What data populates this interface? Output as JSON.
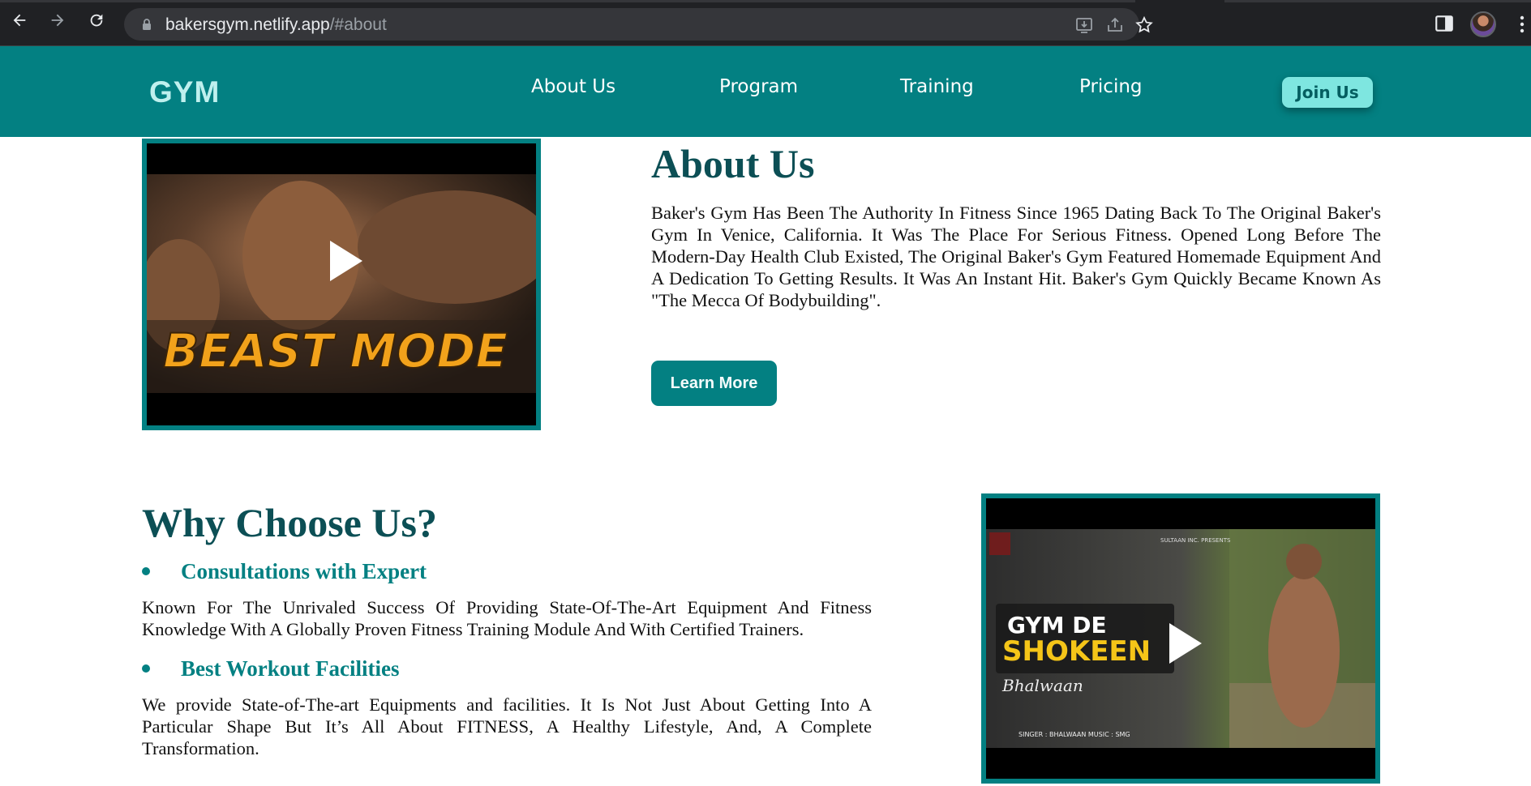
{
  "browser": {
    "url_host": "bakersgym.netlify.app",
    "url_path": "/#about"
  },
  "header": {
    "logo": "GYM",
    "nav": [
      "About Us",
      "Program",
      "Training",
      "Pricing"
    ],
    "cta": "Join Us"
  },
  "about": {
    "title": "About Us",
    "text": "Baker's Gym Has Been The Authority In Fitness Since 1965 Dating Back To The Original Baker's Gym In Venice, California. It Was The Place For Serious Fitness. Opened Long Before The Modern-Day Health Club Existed, The Original Baker's Gym Featured Homemade Equipment And A Dedication To Getting Results. It Was An Instant Hit. Baker's Gym Quickly Became Known As \"The Mecca Of Bodybuilding\".",
    "button": "Learn More",
    "video_caption": "BEAST MODE"
  },
  "why": {
    "title": "Why Choose Us?",
    "features": [
      {
        "heading": "Consultations with Expert",
        "text": "Known For The Unrivaled Success Of Providing State-Of-The-Art Equipment And Fitness Knowledge With A Globally Proven Fitness Training Module And With Certified Trainers."
      },
      {
        "heading": "Best Workout Facilities",
        "text": "We provide State-of-The-art Equipments and facilities. It Is Not Just About Getting Into A Particular Shape But It’s All About FITNESS, A Healthy Lifestyle, And, A Complete Transformation."
      }
    ],
    "video": {
      "title_line1": "GYM DE",
      "title_line2": "SHOKEEN",
      "signature": "Bhalwaan",
      "credits": "SINGER : BHALWAAN   MUSIC : SMG",
      "presents": "SULTAAN INC. PRESENTS"
    }
  },
  "colors": {
    "brand_teal": "#038082",
    "heading_dark_teal": "#0c4f55",
    "join_button": "#7ee6e0",
    "logo": "#bff0ee"
  }
}
